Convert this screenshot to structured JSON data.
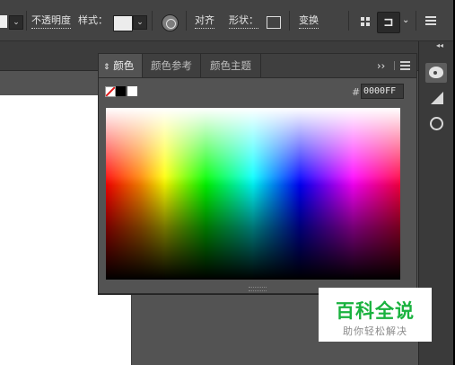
{
  "control_bar": {
    "dropdown_glyph": "⌄",
    "opacity_label": "不透明度",
    "style_label": "样式：",
    "align_label": "对齐",
    "shape_label": "形状：",
    "transform_label": "变换",
    "isolate_glyph": "⊐"
  },
  "icons": {
    "recolor": "recolor-artwork-icon",
    "shape": "shape-rectangle-icon",
    "grid": "align-grid-icon",
    "menu": "menu-icon",
    "palette": "color-palette-icon",
    "gradient": "gradient-icon",
    "nodes": "color-guide-icon"
  },
  "color_panel": {
    "tabs": [
      {
        "label": "颜色",
        "active": true
      },
      {
        "label": "颜色参考",
        "active": false
      },
      {
        "label": "颜色主题",
        "active": false
      }
    ],
    "tab_prefix": "⇕",
    "overflow_glyph": "››",
    "hash_label": "#",
    "hex_value": "0000FF",
    "spectrum_colors": [
      "#ff0000",
      "#ffff00",
      "#00ff00",
      "#00ffff",
      "#0000ff",
      "#ff00ff"
    ]
  },
  "dock": {
    "collapse_glyph": "◂◂"
  },
  "watermark": {
    "title": "百科全说",
    "subtitle": "助你轻松解决",
    "color": "#19b23e"
  }
}
